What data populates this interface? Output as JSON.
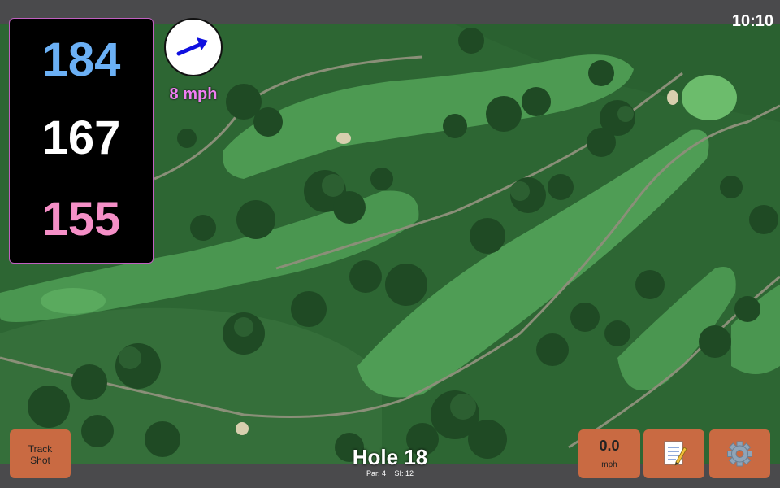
{
  "status": {
    "time": "10:10"
  },
  "distances": {
    "back": "184",
    "middle": "167",
    "front": "155"
  },
  "wind": {
    "speed": "8 mph",
    "icon": "wind-arrow-icon",
    "arrow_color": "#1010e0"
  },
  "hole": {
    "title": "Hole 18",
    "par": "Par: 4",
    "si": "SI: 12"
  },
  "buttons": {
    "track_shot_line1": "Track",
    "track_shot_line2": "Shot",
    "speed_value": "0.0",
    "speed_unit": "mph",
    "notes_icon": "notepad-icon",
    "settings_icon": "gear-icon"
  },
  "colors": {
    "back_distance": "#6bb0f5",
    "middle_distance": "#ffffff",
    "front_distance": "#f58fc7",
    "wind_text": "#f07ef2",
    "button": "#c96a42"
  }
}
